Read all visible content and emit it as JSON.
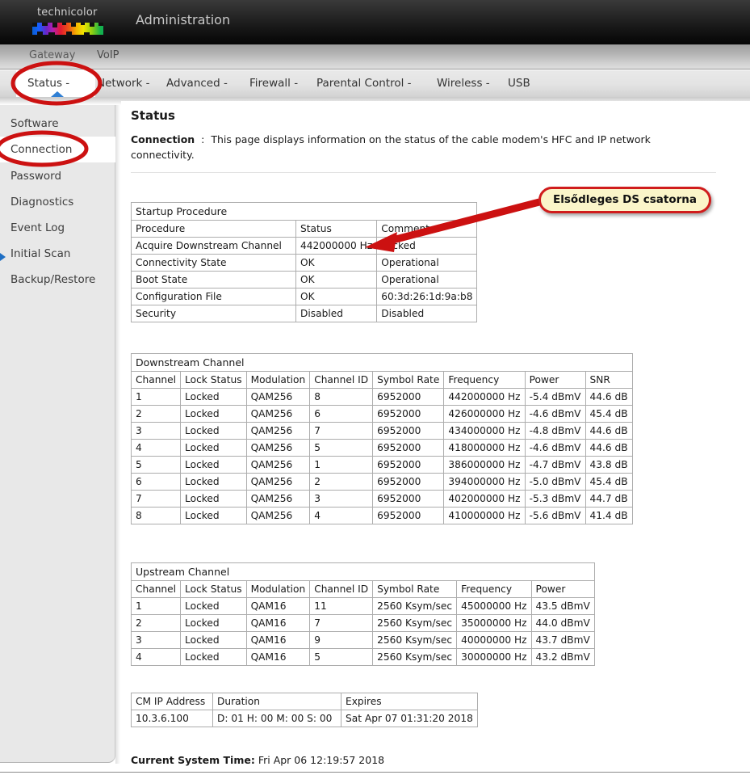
{
  "brand": {
    "logo_word": "technicolor",
    "admin_title": "Administration"
  },
  "top_nav": {
    "items": [
      {
        "label": "Gateway",
        "active": true
      },
      {
        "label": "VoIP",
        "active": false
      }
    ]
  },
  "menu_bar": {
    "items": [
      {
        "label": "Status -",
        "active": true
      },
      {
        "label": "Network -",
        "active": false
      },
      {
        "label": "Advanced -",
        "active": false
      },
      {
        "label": "Firewall -",
        "active": false
      },
      {
        "label": "Parental Control -",
        "active": false
      },
      {
        "label": "Wireless -",
        "active": false
      },
      {
        "label": "USB",
        "active": false
      }
    ]
  },
  "sidebar": {
    "items": [
      {
        "label": "Software",
        "active": false
      },
      {
        "label": "Connection",
        "active": true
      },
      {
        "label": "Password",
        "active": false
      },
      {
        "label": "Diagnostics",
        "active": false
      },
      {
        "label": "Event Log",
        "active": false
      },
      {
        "label": "Initial Scan",
        "active": false
      },
      {
        "label": "Backup/Restore",
        "active": false
      }
    ]
  },
  "main": {
    "page_title": "Status",
    "desc_label": "Connection",
    "desc_separator": ":",
    "desc_text": "This page displays information on the status of the cable modem's HFC and IP network connectivity.",
    "current_system_time_label": "Current System Time:",
    "current_system_time_value": "Fri Apr 06 12:19:57 2018"
  },
  "startup_table": {
    "title": "Startup Procedure",
    "headers": [
      "Procedure",
      "Status",
      "Comment"
    ],
    "rows": [
      [
        "Acquire Downstream Channel",
        "442000000 Hz",
        "Locked"
      ],
      [
        "Connectivity State",
        "OK",
        "Operational"
      ],
      [
        "Boot State",
        "OK",
        "Operational"
      ],
      [
        "Configuration File",
        "OK",
        "60:3d:26:1d:9a:b8"
      ],
      [
        "Security",
        "Disabled",
        "Disabled"
      ]
    ]
  },
  "downstream_table": {
    "title": "Downstream Channel",
    "headers": [
      "Channel",
      "Lock Status",
      "Modulation",
      "Channel ID",
      "Symbol Rate",
      "Frequency",
      "Power",
      "SNR"
    ],
    "rows": [
      [
        "1",
        "Locked",
        "QAM256",
        "8",
        "6952000",
        "442000000 Hz",
        "-5.4 dBmV",
        "44.6 dB"
      ],
      [
        "2",
        "Locked",
        "QAM256",
        "6",
        "6952000",
        "426000000 Hz",
        "-4.6 dBmV",
        "45.4 dB"
      ],
      [
        "3",
        "Locked",
        "QAM256",
        "7",
        "6952000",
        "434000000 Hz",
        "-4.8 dBmV",
        "44.6 dB"
      ],
      [
        "4",
        "Locked",
        "QAM256",
        "5",
        "6952000",
        "418000000 Hz",
        "-4.6 dBmV",
        "44.6 dB"
      ],
      [
        "5",
        "Locked",
        "QAM256",
        "1",
        "6952000",
        "386000000 Hz",
        "-4.7 dBmV",
        "43.8 dB"
      ],
      [
        "6",
        "Locked",
        "QAM256",
        "2",
        "6952000",
        "394000000 Hz",
        "-5.0 dBmV",
        "45.4 dB"
      ],
      [
        "7",
        "Locked",
        "QAM256",
        "3",
        "6952000",
        "402000000 Hz",
        "-5.3 dBmV",
        "44.7 dB"
      ],
      [
        "8",
        "Locked",
        "QAM256",
        "4",
        "6952000",
        "410000000 Hz",
        "-5.6 dBmV",
        "41.4 dB"
      ]
    ]
  },
  "upstream_table": {
    "title": "Upstream Channel",
    "headers": [
      "Channel",
      "Lock Status",
      "Modulation",
      "Channel ID",
      "Symbol Rate",
      "Frequency",
      "Power"
    ],
    "rows": [
      [
        "1",
        "Locked",
        "QAM16",
        "11",
        "2560 Ksym/sec",
        "45000000 Hz",
        "43.5 dBmV"
      ],
      [
        "2",
        "Locked",
        "QAM16",
        "7",
        "2560 Ksym/sec",
        "35000000 Hz",
        "44.0 dBmV"
      ],
      [
        "3",
        "Locked",
        "QAM16",
        "9",
        "2560 Ksym/sec",
        "40000000 Hz",
        "43.7 dBmV"
      ],
      [
        "4",
        "Locked",
        "QAM16",
        "5",
        "2560 Ksym/sec",
        "30000000 Hz",
        "43.2 dBmV"
      ]
    ]
  },
  "cmip_table": {
    "headers": [
      "CM IP Address",
      "Duration",
      "Expires"
    ],
    "rows": [
      [
        "10.3.6.100",
        "D: 01 H: 00 M: 00 S: 00",
        "Sat Apr 07 01:31:20 2018"
      ]
    ]
  },
  "annotations": {
    "callout_text": "Elsődleges DS csatorna",
    "callout_fill": "#fbf5c9",
    "callout_border": "#d01c1c",
    "highlight_color": "#cc1111",
    "ellipses": [
      {
        "name": "status-tab-highlight"
      },
      {
        "name": "connection-sidebar-highlight"
      }
    ]
  }
}
